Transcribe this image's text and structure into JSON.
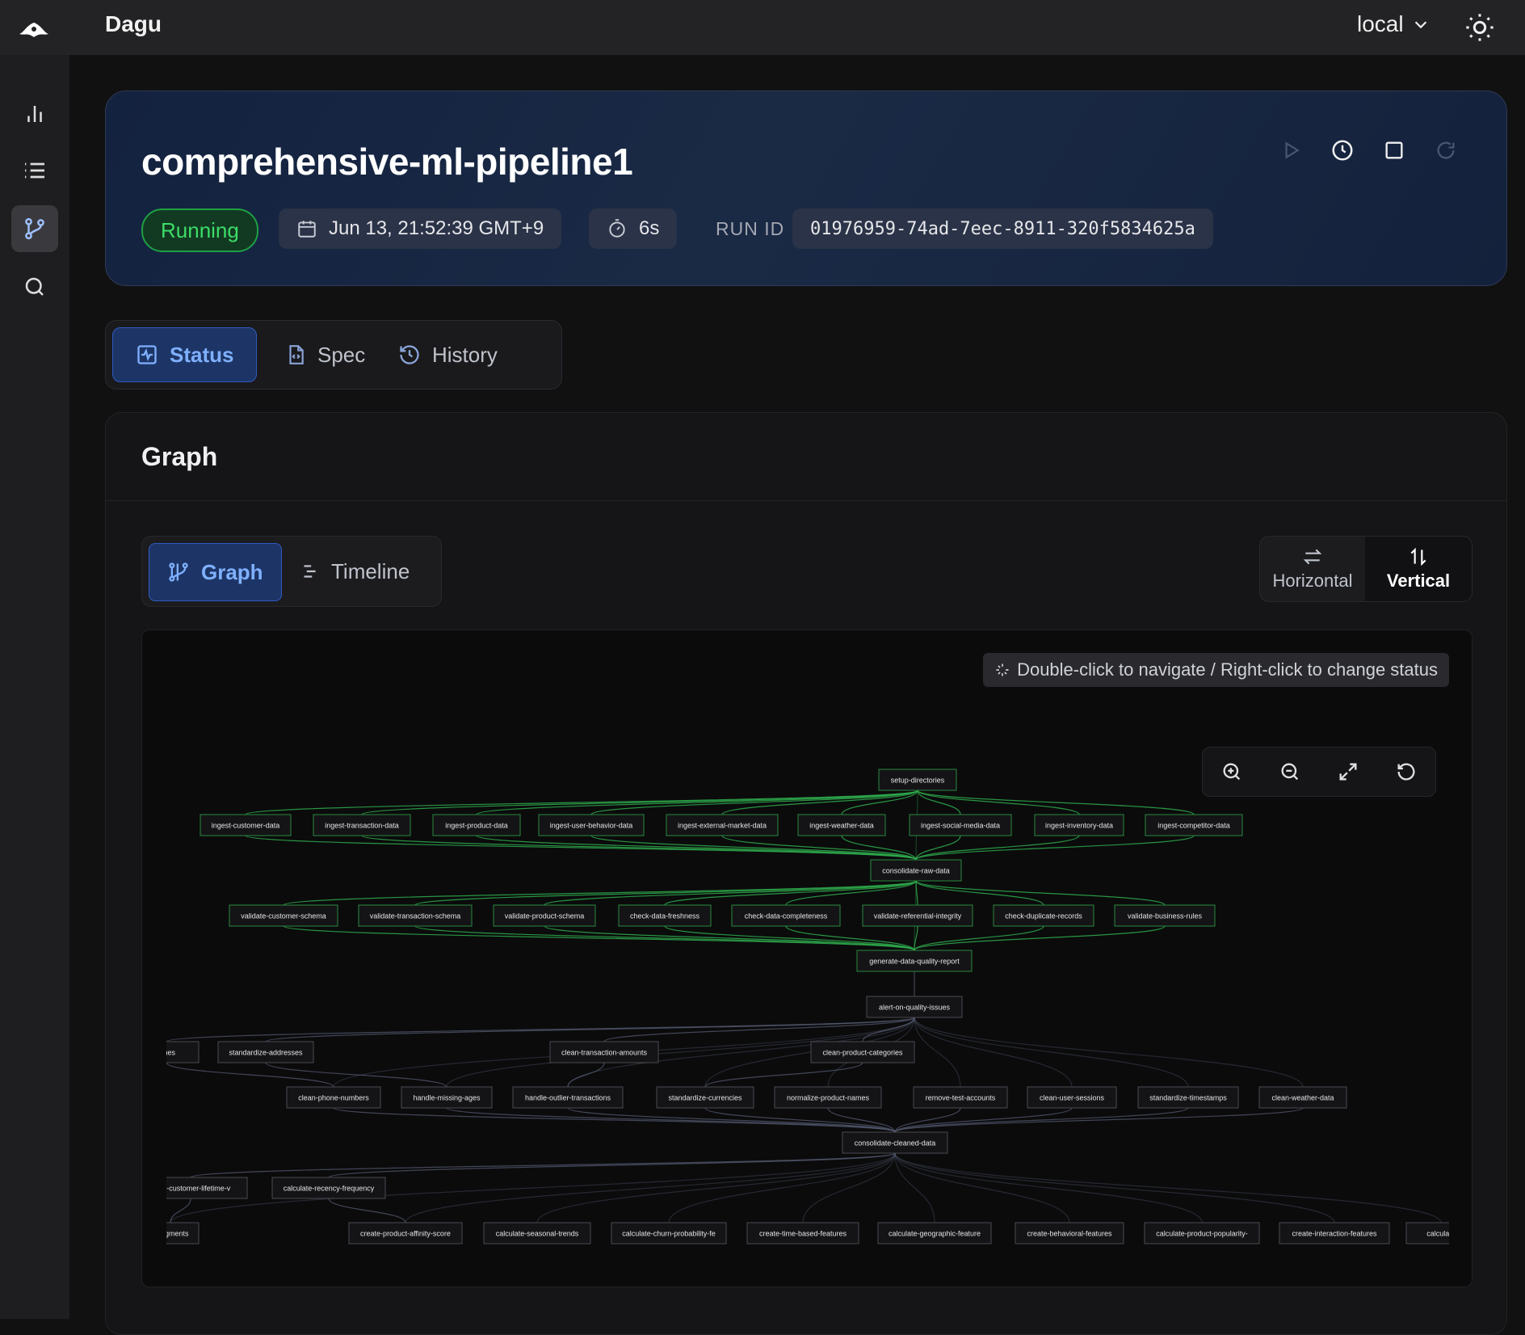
{
  "app": {
    "name": "Dagu",
    "environment": "local"
  },
  "header": {
    "title": "comprehensive-ml-pipeline1",
    "status": "Running",
    "started_at": "Jun 13, 21:52:39 GMT+9",
    "duration": "6s",
    "run_id_label": "RUN ID",
    "run_id": "01976959-74ad-7eec-8911-320f5834625a"
  },
  "tabs": [
    {
      "label": "Status",
      "active": true
    },
    {
      "label": "Spec",
      "active": false
    },
    {
      "label": "History",
      "active": false
    }
  ],
  "section": {
    "title": "Graph"
  },
  "view_tabs": [
    {
      "label": "Graph",
      "active": true
    },
    {
      "label": "Timeline",
      "active": false
    }
  ],
  "orientation": [
    {
      "label": "Horizontal",
      "active": false
    },
    {
      "label": "Vertical",
      "active": true
    }
  ],
  "graph": {
    "hint": "Double-click to navigate / Right-click to change status",
    "rows": [
      [
        {
          "label": "setup-directories",
          "status": "success"
        }
      ],
      [
        {
          "label": "ingest-customer-data",
          "status": "success"
        },
        {
          "label": "ingest-transaction-data",
          "status": "success"
        },
        {
          "label": "ingest-product-data",
          "status": "success"
        },
        {
          "label": "ingest-user-behavior-data",
          "status": "success"
        },
        {
          "label": "ingest-external-market-data",
          "status": "success"
        },
        {
          "label": "ingest-weather-data",
          "status": "success"
        },
        {
          "label": "ingest-social-media-data",
          "status": "success"
        },
        {
          "label": "ingest-inventory-data",
          "status": "success"
        },
        {
          "label": "ingest-competitor-data",
          "status": "success"
        }
      ],
      [
        {
          "label": "consolidate-raw-data",
          "status": "success"
        }
      ],
      [
        {
          "label": "validate-customer-schema",
          "status": "success"
        },
        {
          "label": "validate-transaction-schema",
          "status": "success"
        },
        {
          "label": "validate-product-schema",
          "status": "success"
        },
        {
          "label": "check-data-freshness",
          "status": "success"
        },
        {
          "label": "check-data-completeness",
          "status": "success"
        },
        {
          "label": "validate-referential-integrity",
          "status": "success"
        },
        {
          "label": "check-duplicate-records",
          "status": "success"
        },
        {
          "label": "validate-business-rules",
          "status": "success"
        }
      ],
      [
        {
          "label": "generate-data-quality-report",
          "status": "success"
        }
      ],
      [
        {
          "label": "alert-on-quality-issues",
          "status": "pending"
        }
      ],
      [
        {
          "label": "ames",
          "status": "pending"
        },
        {
          "label": "standardize-addresses",
          "status": "pending"
        },
        {
          "label": "clean-transaction-amounts",
          "status": "pending"
        },
        {
          "label": "clean-product-categories",
          "status": "pending"
        }
      ],
      [
        {
          "label": "clean-phone-numbers",
          "status": "pending"
        },
        {
          "label": "handle-missing-ages",
          "status": "pending"
        },
        {
          "label": "handle-outlier-transactions",
          "status": "pending"
        },
        {
          "label": "standardize-currencies",
          "status": "pending"
        },
        {
          "label": "normalize-product-names",
          "status": "pending"
        },
        {
          "label": "remove-test-accounts",
          "status": "pending"
        },
        {
          "label": "clean-user-sessions",
          "status": "pending"
        },
        {
          "label": "standardize-timestamps",
          "status": "pending"
        },
        {
          "label": "clean-weather-data",
          "status": "pending"
        }
      ],
      [
        {
          "label": "consolidate-cleaned-data",
          "status": "pending"
        }
      ],
      [
        {
          "label": "ulate-customer-lifetime-v",
          "status": "pending"
        },
        {
          "label": "calculate-recency-frequency",
          "status": "pending"
        }
      ],
      [
        {
          "label": "r-segments",
          "status": "pending"
        },
        {
          "label": "create-product-affinity-score",
          "status": "pending"
        },
        {
          "label": "calculate-seasonal-trends",
          "status": "pending"
        },
        {
          "label": "calculate-churn-probability-fe",
          "status": "pending"
        },
        {
          "label": "create-time-based-features",
          "status": "pending"
        },
        {
          "label": "calculate-geographic-feature",
          "status": "pending"
        },
        {
          "label": "create-behavioral-features",
          "status": "pending"
        },
        {
          "label": "calculate-product-popularity-",
          "status": "pending"
        },
        {
          "label": "create-interaction-features",
          "status": "pending"
        },
        {
          "label": "calculate",
          "status": "pending"
        }
      ]
    ],
    "colors": {
      "success_edge": "#2fae4e",
      "success_border": "#2a8a3e",
      "pending_edge": "#5a6078",
      "node_fill": "#141416",
      "pending_border": "#4a4a52"
    }
  },
  "icons": {
    "logo": "dagu-logo-icon",
    "env_chevron": "chevron-down-icon",
    "theme": "sun-icon",
    "nav": [
      "bar-chart-icon",
      "list-icon",
      "git-branch-icon",
      "search-icon"
    ],
    "actions": [
      "play-icon",
      "clock-icon",
      "stop-icon",
      "retry-icon"
    ]
  }
}
